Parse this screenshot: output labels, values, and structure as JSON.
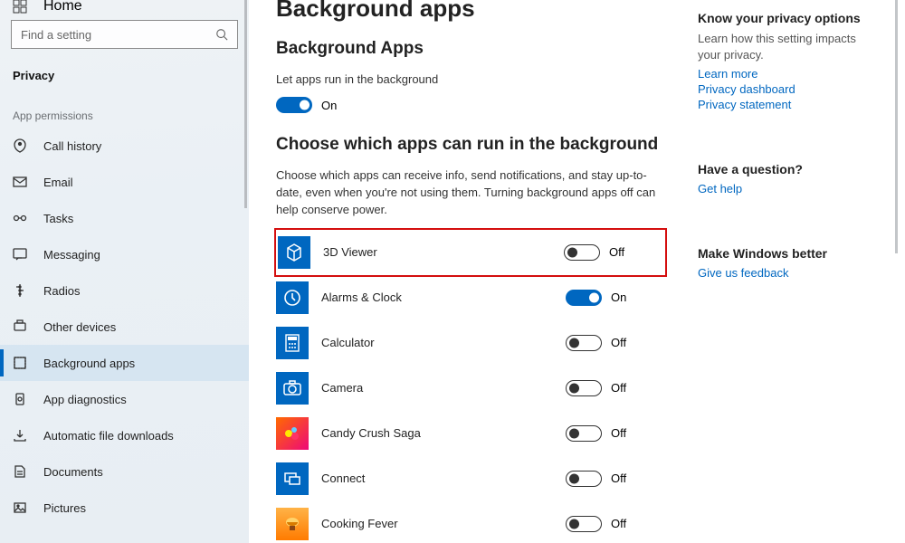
{
  "sidebar": {
    "home_label": "Home",
    "search_placeholder": "Find a setting",
    "category": "Privacy",
    "section_header": "App permissions",
    "items": [
      {
        "label": "Call history"
      },
      {
        "label": "Email"
      },
      {
        "label": "Tasks"
      },
      {
        "label": "Messaging"
      },
      {
        "label": "Radios"
      },
      {
        "label": "Other devices"
      },
      {
        "label": "Background apps"
      },
      {
        "label": "App diagnostics"
      },
      {
        "label": "Automatic file downloads"
      },
      {
        "label": "Documents"
      },
      {
        "label": "Pictures"
      }
    ],
    "active_index": 6
  },
  "page": {
    "title_cut": "Background apps",
    "section1": "Background Apps",
    "master_label": "Let apps run in the background",
    "master_state": "On",
    "section2": "Choose which apps can run in the background",
    "description": "Choose which apps can receive info, send notifications, and stay up-to-date, even when you're not using them. Turning background apps off can help conserve power.",
    "state_on": "On",
    "state_off": "Off",
    "apps": [
      {
        "name": "3D Viewer",
        "on": false,
        "highlight": true
      },
      {
        "name": "Alarms & Clock",
        "on": true
      },
      {
        "name": "Calculator",
        "on": false
      },
      {
        "name": "Camera",
        "on": false
      },
      {
        "name": "Candy Crush Saga",
        "on": false
      },
      {
        "name": "Connect",
        "on": false
      },
      {
        "name": "Cooking Fever",
        "on": false
      }
    ]
  },
  "rail": {
    "b1_head": "Know your privacy options",
    "b1_text": "Learn how this setting impacts your privacy.",
    "b1_links": [
      "Learn more",
      "Privacy dashboard",
      "Privacy statement"
    ],
    "b2_head": "Have a question?",
    "b2_link": "Get help",
    "b3_head": "Make Windows better",
    "b3_link": "Give us feedback"
  }
}
